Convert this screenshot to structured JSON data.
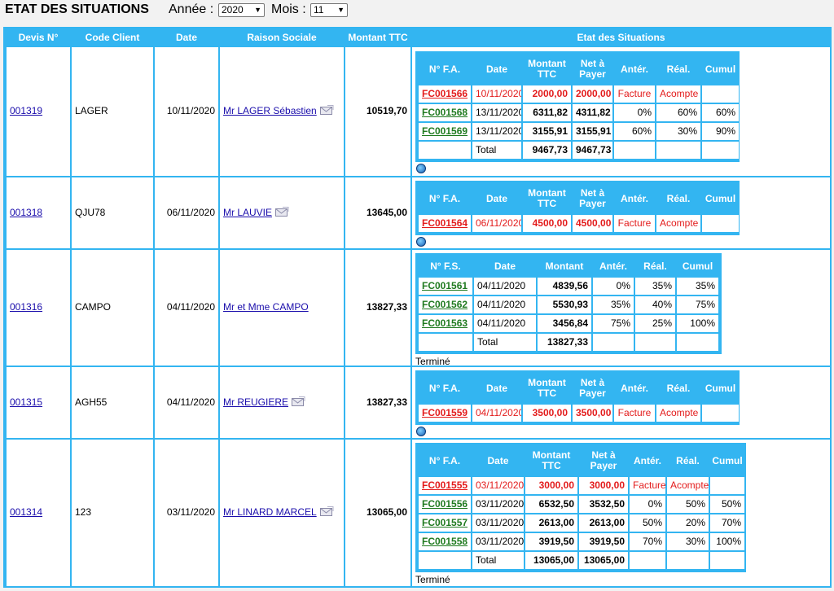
{
  "header": {
    "title": "ETAT DES SITUATIONS",
    "annee_label": "Année :",
    "annee_value": "2020",
    "mois_label": "Mois :",
    "mois_value": "11"
  },
  "columns": {
    "devis": "Devis N°",
    "code": "Code Client",
    "date": "Date",
    "raison": "Raison Sociale",
    "montant": "Montant TTC",
    "etat": "Etat des Situations"
  },
  "fa_headers": [
    "N° F.A.",
    "Date",
    "Montant TTC",
    "Net à Payer",
    "Antér.",
    "Réal.",
    "Cumul"
  ],
  "fs_headers": [
    "N° F.S.",
    "Date",
    "Montant",
    "Antér.",
    "Réal.",
    "Cumul"
  ],
  "colors": {
    "accent": "#33b5f1",
    "red": "#e31b1b",
    "green": "#1f7a1f",
    "link": "#1a0dab"
  },
  "rows": [
    {
      "devis": "001319",
      "code": "LAGER",
      "date": "10/11/2020",
      "raison": "Mr LAGER Sébastien",
      "montant": "10519,70",
      "invoices": [
        {
          "num": "FC001566",
          "date": "10/11/2020",
          "ttc": "2000,00",
          "net": "2000,00",
          "anter": "Facture",
          "real": "Acompte",
          "cumul": ""
        },
        {
          "num": "FC001568",
          "date": "13/11/2020",
          "ttc": "6311,82",
          "net": "4311,82",
          "anter": "0%",
          "real": "60%",
          "cumul": "60%"
        },
        {
          "num": "FC001569",
          "date": "13/11/2020",
          "ttc": "3155,91",
          "net": "3155,91",
          "anter": "60%",
          "real": "30%",
          "cumul": "90%"
        }
      ],
      "total_label": "Total",
      "total_ttc": "9467,73",
      "total_net": "9467,73"
    },
    {
      "devis": "001318",
      "code": "QJU78",
      "date": "06/11/2020",
      "raison": "Mr LAUVIE",
      "montant": "13645,00",
      "invoices": [
        {
          "num": "FC001564",
          "date": "06/11/2020",
          "ttc": "4500,00",
          "net": "4500,00",
          "anter": "Facture",
          "real": "Acompte",
          "cumul": ""
        }
      ]
    },
    {
      "devis": "001316",
      "code": "CAMPO",
      "date": "04/11/2020",
      "raison": "Mr et Mme CAMPO",
      "montant": "13827,33",
      "invoices": [
        {
          "num": "FC001561",
          "date": "04/11/2020",
          "montant": "4839,56",
          "anter": "0%",
          "real": "35%",
          "cumul": "35%"
        },
        {
          "num": "FC001562",
          "date": "04/11/2020",
          "montant": "5530,93",
          "anter": "35%",
          "real": "40%",
          "cumul": "75%"
        },
        {
          "num": "FC001563",
          "date": "04/11/2020",
          "montant": "3456,84",
          "anter": "75%",
          "real": "25%",
          "cumul": "100%"
        }
      ],
      "total_label": "Total",
      "total_montant": "13827,33",
      "status": "Terminé"
    },
    {
      "devis": "001315",
      "code": "AGH55",
      "date": "04/11/2020",
      "raison": "Mr REUGIERE",
      "montant": "13827,33",
      "invoices": [
        {
          "num": "FC001559",
          "date": "04/11/2020",
          "ttc": "3500,00",
          "net": "3500,00",
          "anter": "Facture",
          "real": "Acompte",
          "cumul": ""
        }
      ]
    },
    {
      "devis": "001314",
      "code": "123",
      "date": "03/11/2020",
      "raison": "Mr LINARD MARCEL",
      "montant": "13065,00",
      "invoices": [
        {
          "num": "FC001555",
          "date": "03/11/2020",
          "ttc": "3000,00",
          "net": "3000,00",
          "anter": "Facture",
          "real": "Acompte",
          "cumul": ""
        },
        {
          "num": "FC001556",
          "date": "03/11/2020",
          "ttc": "6532,50",
          "net": "3532,50",
          "anter": "0%",
          "real": "50%",
          "cumul": "50%"
        },
        {
          "num": "FC001557",
          "date": "03/11/2020",
          "ttc": "2613,00",
          "net": "2613,00",
          "anter": "50%",
          "real": "20%",
          "cumul": "70%"
        },
        {
          "num": "FC001558",
          "date": "03/11/2020",
          "ttc": "3919,50",
          "net": "3919,50",
          "anter": "70%",
          "real": "30%",
          "cumul": "100%"
        }
      ],
      "total_label": "Total",
      "total_ttc": "13065,00",
      "total_net": "13065,00",
      "status": "Terminé"
    }
  ]
}
